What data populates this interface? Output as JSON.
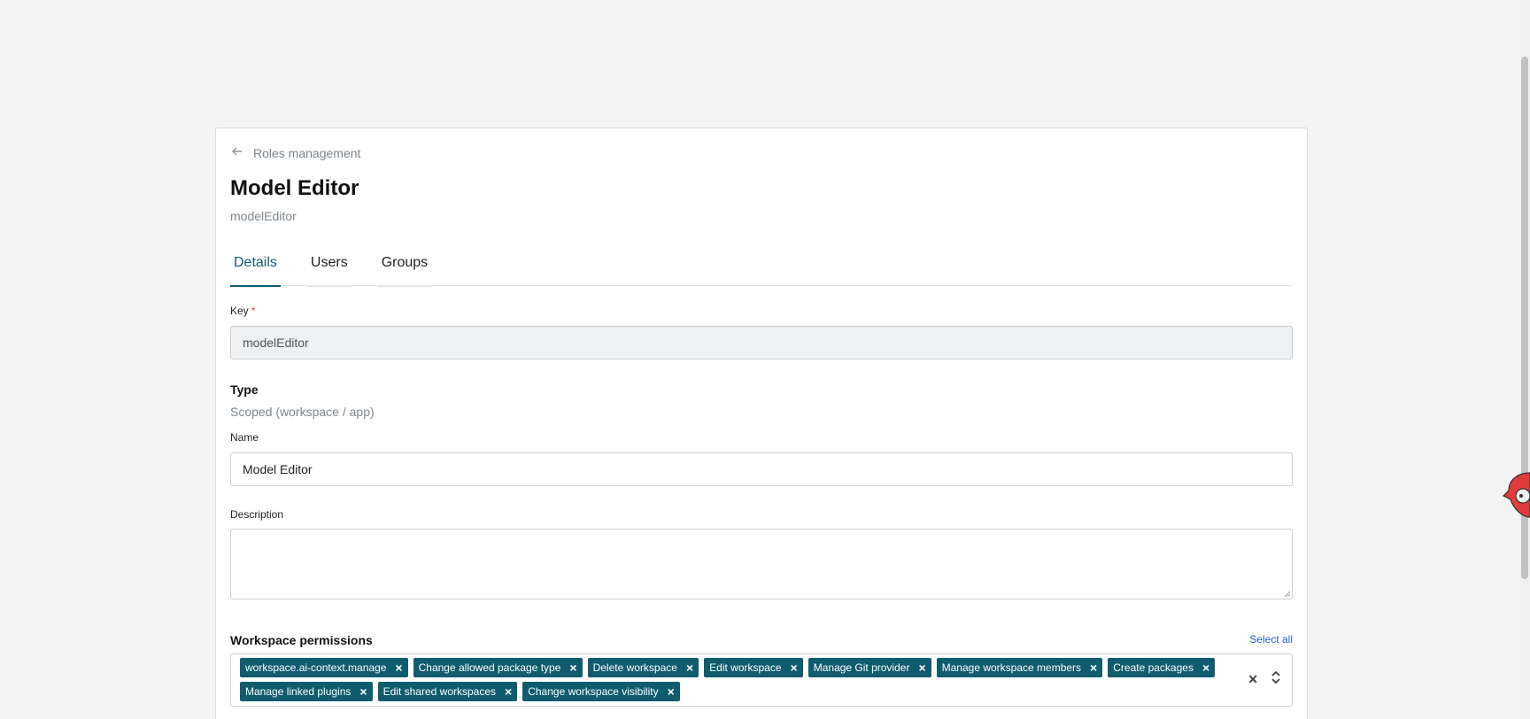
{
  "breadcrumb": {
    "label": "Roles management",
    "icon": "arrow-left-icon"
  },
  "header": {
    "title": "Model Editor",
    "subtitle": "modelEditor"
  },
  "tabs": [
    {
      "label": "Details",
      "active": true
    },
    {
      "label": "Users",
      "active": false
    },
    {
      "label": "Groups",
      "active": false
    }
  ],
  "form": {
    "key": {
      "label": "Key",
      "required_mark": "*",
      "value": "modelEditor"
    },
    "type": {
      "label": "Type",
      "value": "Scoped (workspace / app)"
    },
    "name": {
      "label": "Name",
      "value": "Model Editor"
    },
    "description": {
      "label": "Description",
      "value": ""
    }
  },
  "workspace_permissions": {
    "label": "Workspace permissions",
    "select_all_label": "Select all",
    "chips": [
      "workspace.ai-context.manage",
      "Change allowed package type",
      "Delete workspace",
      "Edit workspace",
      "Manage Git provider",
      "Manage workspace members",
      "Create packages",
      "Manage linked plugins",
      "Edit shared workspaces",
      "Change workspace visibility"
    ],
    "remove_glyph": "×",
    "clear_glyph": "✕",
    "chevrons_glyph": "⇕"
  },
  "colors": {
    "accent": "#0f5c6e",
    "link": "#2463c8",
    "required": "#d43a3a",
    "page_bg": "#f3f4f3"
  }
}
